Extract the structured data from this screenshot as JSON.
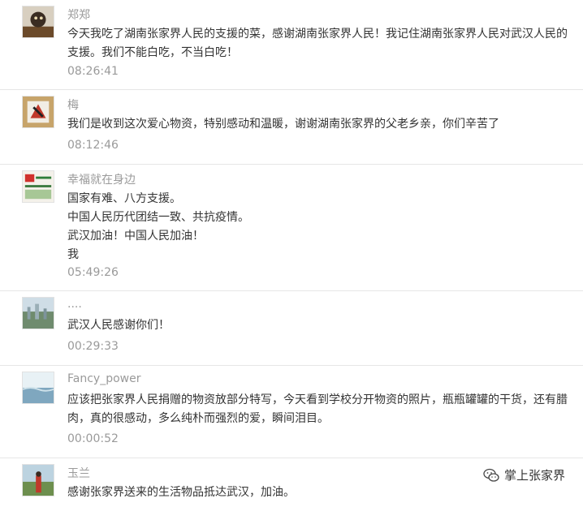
{
  "comments": [
    {
      "name": "郑郑",
      "lines": [
        "今天我吃了湖南张家界人民的支援的菜，感谢湖南张家界人民！我记住湖南张家界人民对武汉人民的",
        "支援。我们不能白吃，不当白吃！"
      ],
      "time": "08:26:41"
    },
    {
      "name": "梅",
      "lines": [
        "我们是收到这次爱心物资，特别感动和温暖，谢谢湖南张家界的父老乡亲，你们辛苦了"
      ],
      "time": "08:12:46"
    },
    {
      "name": "幸福就在身边",
      "lines": [
        "国家有难、八方支援。",
        "中国人民历代团结一致、共抗疫情。",
        "武汉加油！中国人民加油！",
        "我"
      ],
      "time": "05:49:26"
    },
    {
      "name": "....",
      "lines": [
        "武汉人民感谢你们！"
      ],
      "time": "00:29:33"
    },
    {
      "name": "Fancy_power",
      "lines": [
        "应该把张家界人民捐赠的物资放部分特写，今天看到学校分开物资的照片，瓶瓶罐罐的干货，还有腊",
        "肉，真的很感动，多么纯朴而强烈的爱，瞬间泪目。"
      ],
      "time": "00:00:52"
    },
    {
      "name": "玉兰",
      "lines": [
        "感谢张家界送来的生活物品抵达武汉，加油。"
      ],
      "time": ""
    }
  ],
  "watermark": {
    "icon": "wechat-icon",
    "text": "掌上张家界"
  }
}
